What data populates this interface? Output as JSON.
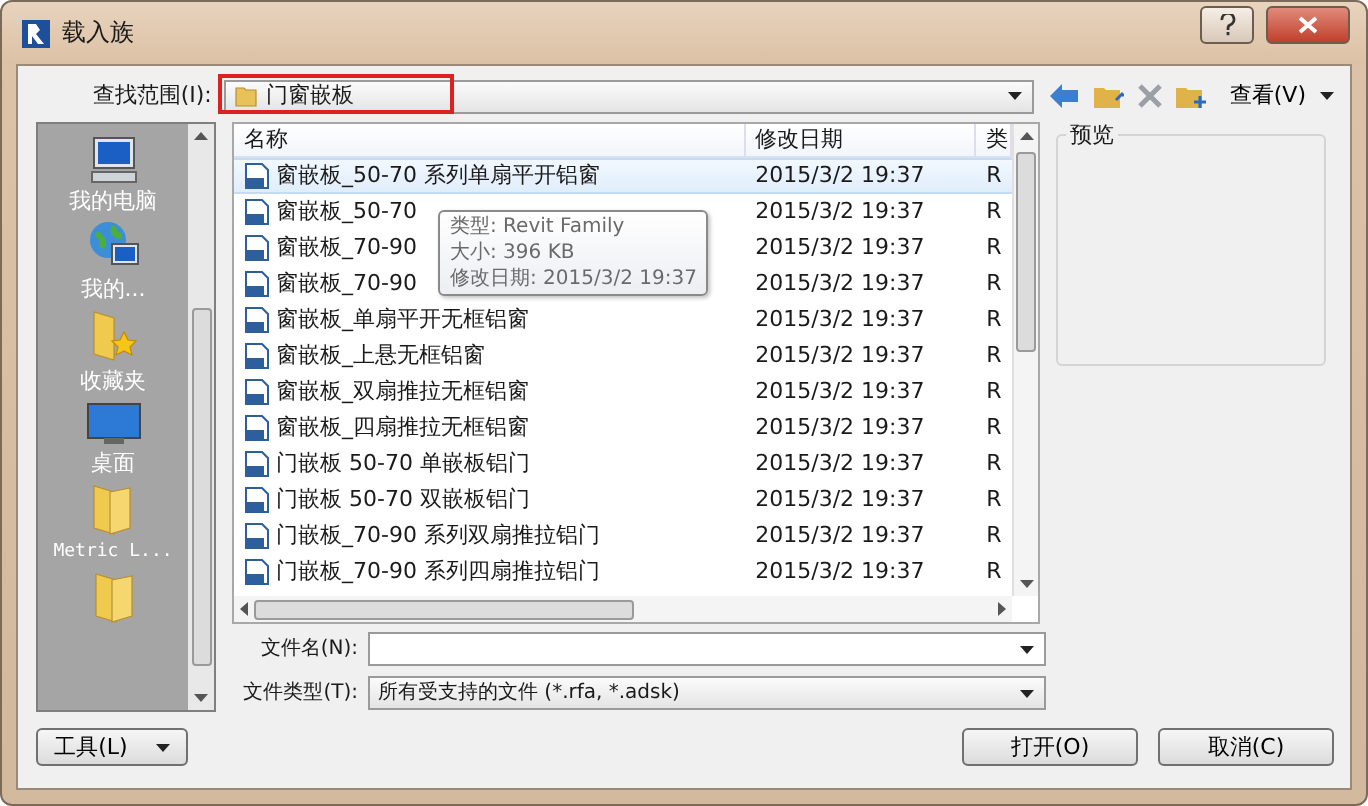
{
  "window": {
    "title": "载入族"
  },
  "look_in": {
    "label": "查找范围(I):",
    "value": "门窗嵌板"
  },
  "toolbar": {
    "view_label": "查看(V)"
  },
  "places": [
    {
      "label": "我的电脑",
      "kind": "computer"
    },
    {
      "label": "我的...",
      "kind": "network"
    },
    {
      "label": "收藏夹",
      "kind": "favorites"
    },
    {
      "label": "桌面",
      "kind": "desktop"
    },
    {
      "label": "Metric L...",
      "kind": "folder"
    },
    {
      "kind": "folder"
    }
  ],
  "file_list": {
    "columns": [
      "名称",
      "修改日期",
      "类"
    ],
    "rows": [
      {
        "name": "窗嵌板_50-70 系列单扇平开铝窗",
        "modified": "2015/3/2 19:37",
        "type": "R",
        "selected": true
      },
      {
        "name": "窗嵌板_50-70",
        "modified": "2015/3/2 19:37",
        "type": "R",
        "selected": false
      },
      {
        "name": "窗嵌板_70-90",
        "modified": "2015/3/2 19:37",
        "type": "R",
        "selected": false
      },
      {
        "name": "窗嵌板_70-90",
        "modified": "2015/3/2 19:37",
        "type": "R",
        "selected": false
      },
      {
        "name": "窗嵌板_单扇平开无框铝窗",
        "modified": "2015/3/2 19:37",
        "type": "R",
        "selected": false
      },
      {
        "name": "窗嵌板_上悬无框铝窗",
        "modified": "2015/3/2 19:37",
        "type": "R",
        "selected": false
      },
      {
        "name": "窗嵌板_双扇推拉无框铝窗",
        "modified": "2015/3/2 19:37",
        "type": "R",
        "selected": false
      },
      {
        "name": "窗嵌板_四扇推拉无框铝窗",
        "modified": "2015/3/2 19:37",
        "type": "R",
        "selected": false
      },
      {
        "name": "门嵌板 50-70 单嵌板铝门",
        "modified": "2015/3/2 19:37",
        "type": "R",
        "selected": false
      },
      {
        "name": "门嵌板 50-70 双嵌板铝门",
        "modified": "2015/3/2 19:37",
        "type": "R",
        "selected": false
      },
      {
        "name": "门嵌板_70-90 系列双扇推拉铝门",
        "modified": "2015/3/2 19:37",
        "type": "R",
        "selected": false
      },
      {
        "name": "门嵌板_70-90 系列四扇推拉铝门",
        "modified": "2015/3/2 19:37",
        "type": "R",
        "selected": false
      }
    ]
  },
  "tooltip": {
    "lines": [
      "类型: Revit Family",
      "大小: 396 KB",
      "修改日期: 2015/3/2 19:37"
    ]
  },
  "preview": {
    "label": "预览"
  },
  "file_name": {
    "label": "文件名(N):"
  },
  "file_type": {
    "label": "文件类型(T):",
    "value": "所有受支持的文件 (*.rfa, *.adsk)"
  },
  "buttons": [
    {
      "label": "工具(L)",
      "kind": "menu"
    },
    {
      "label": "打开(O)",
      "kind": "normal"
    },
    {
      "label": "取消(C)",
      "kind": "normal"
    }
  ]
}
